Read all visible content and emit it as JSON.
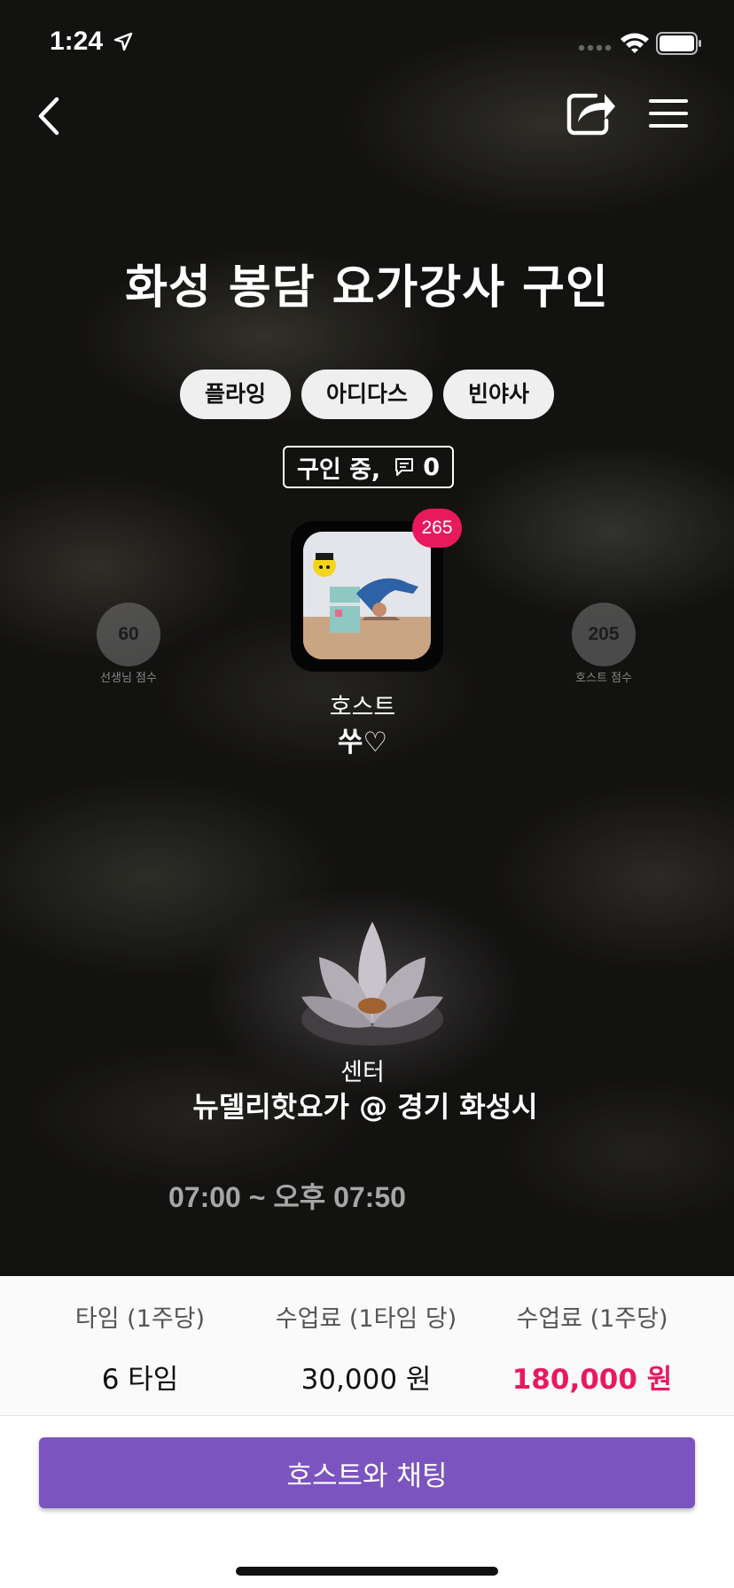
{
  "status_bar": {
    "time": "1:24"
  },
  "header": {
    "title": "화성 봉담 요가강사 구인"
  },
  "tags": [
    "플라잉",
    "아디다스",
    "빈야사"
  ],
  "recruit_status": {
    "label": "구인 중,",
    "comment_count": "0"
  },
  "host": {
    "badge_count": "265",
    "label": "호스트",
    "name": "쑤♡"
  },
  "scores": {
    "teacher": {
      "value": "60",
      "label": "선생님 점수"
    },
    "host": {
      "value": "205",
      "label": "호스트 점수"
    }
  },
  "center": {
    "label": "센터",
    "name": "뉴델리핫요가 @ 경기 화성시"
  },
  "schedule": {
    "time_range": "07:00 ~ 오후 07:50"
  },
  "info": [
    {
      "label": "타임 (1주당)",
      "value": "6 타임"
    },
    {
      "label": "수업료 (1타임 당)",
      "value": "30,000 원"
    },
    {
      "label": "수업료 (1주당)",
      "value": "180,000 원"
    }
  ],
  "chat_button": {
    "label": "호스트와 채팅"
  },
  "colors": {
    "accent_pink": "#e8195d",
    "button_purple": "#7b54bf"
  },
  "icons": [
    "location-arrow-icon",
    "signal-icon",
    "wifi-icon",
    "battery-icon",
    "back-icon",
    "share-icon",
    "menu-icon",
    "chat-bubble-icon"
  ]
}
